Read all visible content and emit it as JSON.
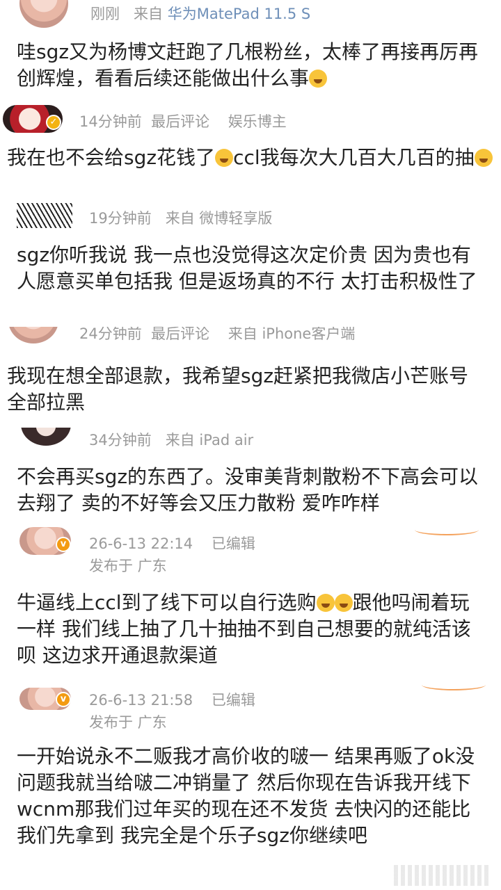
{
  "comments": [
    {
      "time": "刚刚",
      "source_prefix": "来自",
      "device": "华为MatePad 11.5 S",
      "text": "哇sgz又为杨博文赶跑了几根粉丝，太棒了再接再厉再创辉煌，看看后续还能做出什么事"
    },
    {
      "meta": "14分钟前  最后评论    娱乐博主",
      "text": "我在也不会给sgz花钱了",
      "text_2": "ccl我每次大几百大几百的抽"
    },
    {
      "meta": "19分钟前   来自 微博轻享版",
      "text": "sgz你听我说 我一点也没觉得这次定价贵 因为贵也有人愿意买单包括我 但是返场真的不行 太打击积极性了"
    },
    {
      "meta": "24分钟前  最后评论    来自 iPhone客户端",
      "text": "我现在想全部退款，我希望sgz赶紧把我微店小芒账号全部拉黑"
    },
    {
      "meta": "34分钟前   来自 iPad air",
      "text": "不会再买sgz的东西了。没审美背刺散粉不下高会可以去翔了 卖的不好等会又压力散粉 爱咋咋样"
    },
    {
      "meta": "26-6-13 22:14    已编辑",
      "meta_2": "发布于 广东",
      "text": "牛逼线上ccl到了线下可以自行选购",
      "text_2": "跟他吗闹着玩一样 我们线上抽了几十抽抽不到自己想要的就纯活该呗 这边求开通退款渠道"
    },
    {
      "meta": "26-6-13 21:58    已编辑",
      "meta_2": "发布于 广东",
      "text": "一开始说永不二贩我才高价收的啵一 结果再贩了ok没问题我就当给啵二冲销量了 然后你现在告诉我开线下wcnm那我们过年买的现在还不发货 去快闪的还能比我们先拿到 我完全是个乐子sgz你继续吧"
    }
  ],
  "colors": {
    "meta": "#9a9a9a",
    "device": "#6e8fb8",
    "badge": "#f39b12",
    "text": "#222222"
  },
  "icons": [
    "avatar",
    "verified-badge-icon",
    "emoji-icon"
  ]
}
